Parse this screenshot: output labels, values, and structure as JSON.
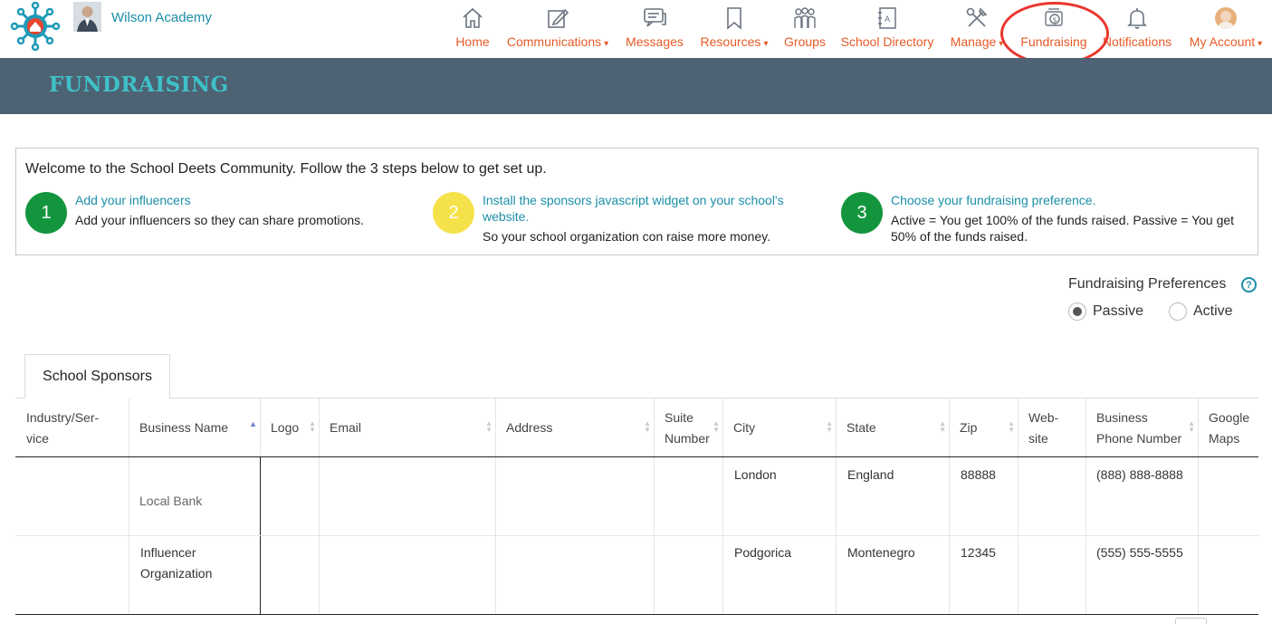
{
  "header": {
    "school_name": "Wilson Academy",
    "nav": [
      {
        "label": "Home",
        "icon": "home-icon"
      },
      {
        "label": "Communications",
        "icon": "edit-icon",
        "caret": "▾"
      },
      {
        "label": "Messages",
        "icon": "chat-icon"
      },
      {
        "label": "Resources",
        "icon": "bookmark-icon",
        "caret": "▾"
      },
      {
        "label": "Groups",
        "icon": "people-icon"
      },
      {
        "label": "School Directory",
        "icon": "directory-icon"
      },
      {
        "label": "Manage",
        "icon": "tools-icon",
        "caret": "▾"
      },
      {
        "label": "Fundraising",
        "icon": "fundraising-icon"
      },
      {
        "label": "Notifications",
        "icon": "bell-icon"
      },
      {
        "label": "My Account",
        "icon": "avatar",
        "caret": "▾"
      }
    ],
    "highlight_color": "#e8372f",
    "nav_color": "#e65a27"
  },
  "banner": {
    "title": "FUNDRAISING",
    "bg_color": "#4d6272",
    "title_color": "#3fc0c8"
  },
  "welcome": {
    "text": "Welcome to the School Deets Community. Follow the 3 steps below to get set up.",
    "steps": [
      {
        "number": "1",
        "color": "#13953e",
        "title": "Add your influencers",
        "desc": "Add your influencers so they can share promotions."
      },
      {
        "number": "2",
        "color": "#f5e24a",
        "title_line1": "Install the sponsors javascript widget on your school's",
        "title_line2": "website.",
        "desc": "So your school organization con raise more money."
      },
      {
        "number": "3",
        "color": "#13953e",
        "title": "Choose your fundraising preference.",
        "desc_line1": "Active = You get 100% of the funds raised. Passive = You get",
        "desc_line2": "50% of the funds raised."
      }
    ]
  },
  "preferences": {
    "title": "Fundraising Preferences",
    "help": "?",
    "options": [
      {
        "label": "Passive",
        "selected": true
      },
      {
        "label": "Active",
        "selected": false
      }
    ]
  },
  "tabs": [
    {
      "label": "School Sponsors",
      "active": true
    }
  ],
  "table": {
    "columns": [
      {
        "line1": "Industry/Ser-",
        "line2": "vice"
      },
      {
        "line1": "Business Name",
        "sort": "asc"
      },
      {
        "line1": "Logo"
      },
      {
        "line1": "Email"
      },
      {
        "line1": "Address"
      },
      {
        "line1": "Suite",
        "line2": "Number"
      },
      {
        "line1": "City"
      },
      {
        "line1": "State"
      },
      {
        "line1": "Zip"
      },
      {
        "line1": "Web-",
        "line2": "site"
      },
      {
        "line1": "Business",
        "line2": "Phone Number"
      },
      {
        "line1": "Google",
        "line2": "Maps"
      }
    ],
    "rows": [
      {
        "business_name": "Local Bank",
        "city": "London",
        "state": "England",
        "zip": "88888",
        "phone": "(888) 888-8888"
      },
      {
        "business_name_line1": "Influencer",
        "business_name_line2": "Organization",
        "city": "Podgorica",
        "state": "Montenegro",
        "zip": "12345",
        "phone": "(555) 555-5555"
      }
    ]
  }
}
